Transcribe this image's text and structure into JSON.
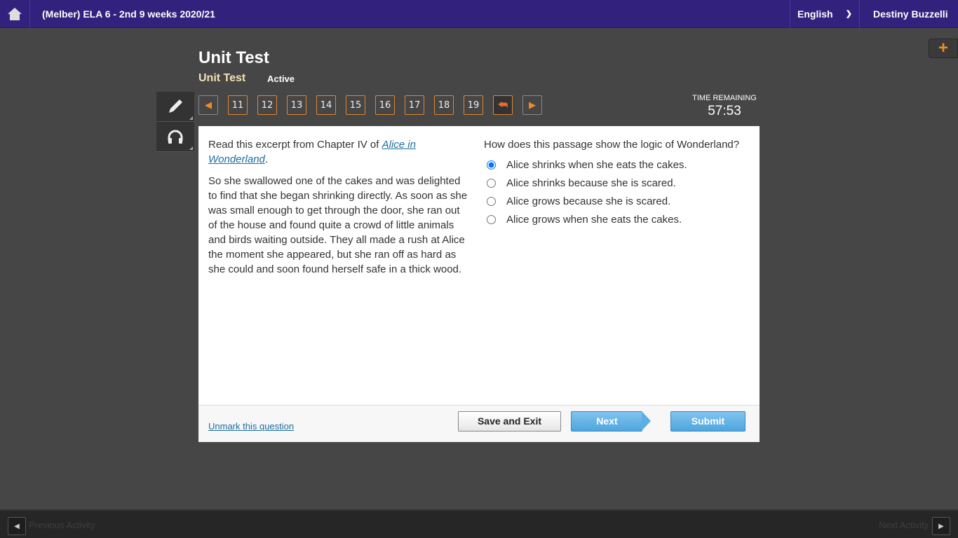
{
  "topbar": {
    "course": "(Melber) ELA 6 - 2nd 9 weeks 2020/21",
    "language": "English",
    "user": "Destiny Buzzelli"
  },
  "header": {
    "title": "Unit Test",
    "subtitle": "Unit Test",
    "status": "Active"
  },
  "nav": {
    "questions": [
      "11",
      "12",
      "13",
      "14",
      "15",
      "16",
      "17",
      "18",
      "19"
    ]
  },
  "timer": {
    "label": "TIME REMAINING",
    "value": "57:53"
  },
  "passage": {
    "intro_prefix": "Read this excerpt from Chapter IV of ",
    "intro_link": "Alice in Wonderland",
    "intro_suffix": ".",
    "text": "So she swallowed one of the cakes and was delighted to find that she began shrinking directly. As soon as she was small enough to get through the door, she ran out of the house and found quite a crowd of little animals and birds waiting outside. They all made a rush at Alice the moment she appeared, but she ran off as hard as she could and soon found herself safe in a thick wood."
  },
  "question": {
    "prompt": "How does this passage show the logic of Wonderland?",
    "options": [
      "Alice shrinks when she eats the cakes.",
      "Alice shrinks because she is scared.",
      "Alice grows because she is scared.",
      "Alice grows when she eats the cakes."
    ],
    "selected": 0
  },
  "footer": {
    "unmark": "Unmark this question",
    "save": "Save and Exit",
    "next": "Next",
    "submit": "Submit"
  },
  "bottom": {
    "prev": "Previous Activity",
    "next": "Next Activity"
  }
}
